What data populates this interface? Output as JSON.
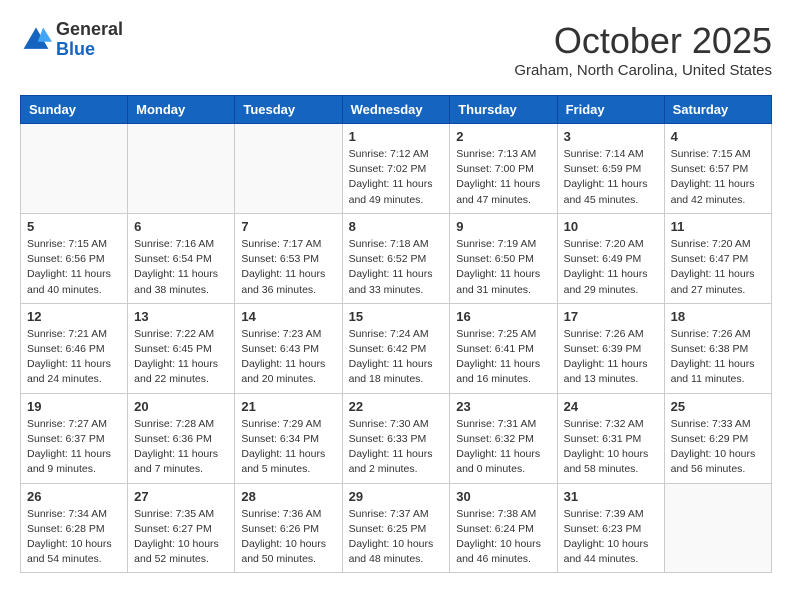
{
  "header": {
    "logo_general": "General",
    "logo_blue": "Blue",
    "month_title": "October 2025",
    "location": "Graham, North Carolina, United States"
  },
  "days_of_week": [
    "Sunday",
    "Monday",
    "Tuesday",
    "Wednesday",
    "Thursday",
    "Friday",
    "Saturday"
  ],
  "weeks": [
    [
      {
        "day": "",
        "info": ""
      },
      {
        "day": "",
        "info": ""
      },
      {
        "day": "",
        "info": ""
      },
      {
        "day": "1",
        "info": "Sunrise: 7:12 AM\nSunset: 7:02 PM\nDaylight: 11 hours\nand 49 minutes."
      },
      {
        "day": "2",
        "info": "Sunrise: 7:13 AM\nSunset: 7:00 PM\nDaylight: 11 hours\nand 47 minutes."
      },
      {
        "day": "3",
        "info": "Sunrise: 7:14 AM\nSunset: 6:59 PM\nDaylight: 11 hours\nand 45 minutes."
      },
      {
        "day": "4",
        "info": "Sunrise: 7:15 AM\nSunset: 6:57 PM\nDaylight: 11 hours\nand 42 minutes."
      }
    ],
    [
      {
        "day": "5",
        "info": "Sunrise: 7:15 AM\nSunset: 6:56 PM\nDaylight: 11 hours\nand 40 minutes."
      },
      {
        "day": "6",
        "info": "Sunrise: 7:16 AM\nSunset: 6:54 PM\nDaylight: 11 hours\nand 38 minutes."
      },
      {
        "day": "7",
        "info": "Sunrise: 7:17 AM\nSunset: 6:53 PM\nDaylight: 11 hours\nand 36 minutes."
      },
      {
        "day": "8",
        "info": "Sunrise: 7:18 AM\nSunset: 6:52 PM\nDaylight: 11 hours\nand 33 minutes."
      },
      {
        "day": "9",
        "info": "Sunrise: 7:19 AM\nSunset: 6:50 PM\nDaylight: 11 hours\nand 31 minutes."
      },
      {
        "day": "10",
        "info": "Sunrise: 7:20 AM\nSunset: 6:49 PM\nDaylight: 11 hours\nand 29 minutes."
      },
      {
        "day": "11",
        "info": "Sunrise: 7:20 AM\nSunset: 6:47 PM\nDaylight: 11 hours\nand 27 minutes."
      }
    ],
    [
      {
        "day": "12",
        "info": "Sunrise: 7:21 AM\nSunset: 6:46 PM\nDaylight: 11 hours\nand 24 minutes."
      },
      {
        "day": "13",
        "info": "Sunrise: 7:22 AM\nSunset: 6:45 PM\nDaylight: 11 hours\nand 22 minutes."
      },
      {
        "day": "14",
        "info": "Sunrise: 7:23 AM\nSunset: 6:43 PM\nDaylight: 11 hours\nand 20 minutes."
      },
      {
        "day": "15",
        "info": "Sunrise: 7:24 AM\nSunset: 6:42 PM\nDaylight: 11 hours\nand 18 minutes."
      },
      {
        "day": "16",
        "info": "Sunrise: 7:25 AM\nSunset: 6:41 PM\nDaylight: 11 hours\nand 16 minutes."
      },
      {
        "day": "17",
        "info": "Sunrise: 7:26 AM\nSunset: 6:39 PM\nDaylight: 11 hours\nand 13 minutes."
      },
      {
        "day": "18",
        "info": "Sunrise: 7:26 AM\nSunset: 6:38 PM\nDaylight: 11 hours\nand 11 minutes."
      }
    ],
    [
      {
        "day": "19",
        "info": "Sunrise: 7:27 AM\nSunset: 6:37 PM\nDaylight: 11 hours\nand 9 minutes."
      },
      {
        "day": "20",
        "info": "Sunrise: 7:28 AM\nSunset: 6:36 PM\nDaylight: 11 hours\nand 7 minutes."
      },
      {
        "day": "21",
        "info": "Sunrise: 7:29 AM\nSunset: 6:34 PM\nDaylight: 11 hours\nand 5 minutes."
      },
      {
        "day": "22",
        "info": "Sunrise: 7:30 AM\nSunset: 6:33 PM\nDaylight: 11 hours\nand 2 minutes."
      },
      {
        "day": "23",
        "info": "Sunrise: 7:31 AM\nSunset: 6:32 PM\nDaylight: 11 hours\nand 0 minutes."
      },
      {
        "day": "24",
        "info": "Sunrise: 7:32 AM\nSunset: 6:31 PM\nDaylight: 10 hours\nand 58 minutes."
      },
      {
        "day": "25",
        "info": "Sunrise: 7:33 AM\nSunset: 6:29 PM\nDaylight: 10 hours\nand 56 minutes."
      }
    ],
    [
      {
        "day": "26",
        "info": "Sunrise: 7:34 AM\nSunset: 6:28 PM\nDaylight: 10 hours\nand 54 minutes."
      },
      {
        "day": "27",
        "info": "Sunrise: 7:35 AM\nSunset: 6:27 PM\nDaylight: 10 hours\nand 52 minutes."
      },
      {
        "day": "28",
        "info": "Sunrise: 7:36 AM\nSunset: 6:26 PM\nDaylight: 10 hours\nand 50 minutes."
      },
      {
        "day": "29",
        "info": "Sunrise: 7:37 AM\nSunset: 6:25 PM\nDaylight: 10 hours\nand 48 minutes."
      },
      {
        "day": "30",
        "info": "Sunrise: 7:38 AM\nSunset: 6:24 PM\nDaylight: 10 hours\nand 46 minutes."
      },
      {
        "day": "31",
        "info": "Sunrise: 7:39 AM\nSunset: 6:23 PM\nDaylight: 10 hours\nand 44 minutes."
      },
      {
        "day": "",
        "info": ""
      }
    ]
  ]
}
